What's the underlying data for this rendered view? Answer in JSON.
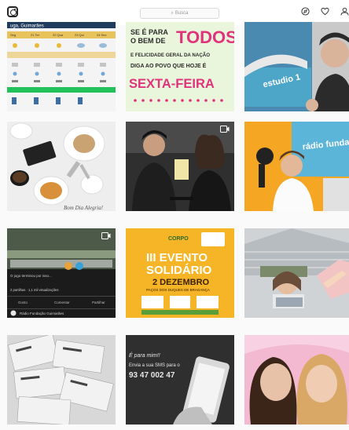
{
  "header": {
    "logo_icon": "instagram-glyph-icon",
    "search": {
      "placeholder": "Busca",
      "icon": "search-icon"
    },
    "nav": [
      {
        "name": "explore-icon"
      },
      {
        "name": "heart-icon"
      },
      {
        "name": "profile-icon"
      }
    ]
  },
  "posts": [
    {
      "id": "weather",
      "location_text": "uga, Guimarães",
      "days": [
        "Seg",
        "21 Ter",
        "22 Qua",
        "23 Qui",
        "24 Sex"
      ]
    },
    {
      "id": "sexta",
      "lines": [
        "SE É PARA",
        "O BEM DE",
        "TODOS",
        "E FELICIDADE GERAL DA NAÇÃO",
        "DIGA AO POVO QUE HOJE É",
        "SEXTA-FEIRA"
      ]
    },
    {
      "id": "estudio",
      "sign_text": "estudio 1"
    },
    {
      "id": "coffee",
      "caption": "Bom Dia Alegria!"
    },
    {
      "id": "radio-studio",
      "video": true
    },
    {
      "id": "radio-fundacao",
      "sign_text": "rádio fundação"
    },
    {
      "id": "fb-video",
      "video": true,
      "post_text": "O jogo terminou por isso...",
      "stats": "2 partilhas · 1,1 mil visualizações",
      "actions": [
        "Gosto",
        "Comentar",
        "Partilhar"
      ],
      "page_name": "Rádio Fundação Guimarães"
    },
    {
      "id": "evento",
      "brand": "CORPO",
      "title_lines": [
        "III EVENTO",
        "SOLIDÁRIO"
      ],
      "date": "2 DEZEMBRO",
      "place": "PAÇOS DOS DUQUES DE BRAGANÇA"
    },
    {
      "id": "arena"
    },
    {
      "id": "tickets"
    },
    {
      "id": "sms",
      "lines": [
        "É para mim!!",
        "Envia a sua SMS para o",
        "93 47 002 47"
      ]
    },
    {
      "id": "selfie"
    }
  ]
}
